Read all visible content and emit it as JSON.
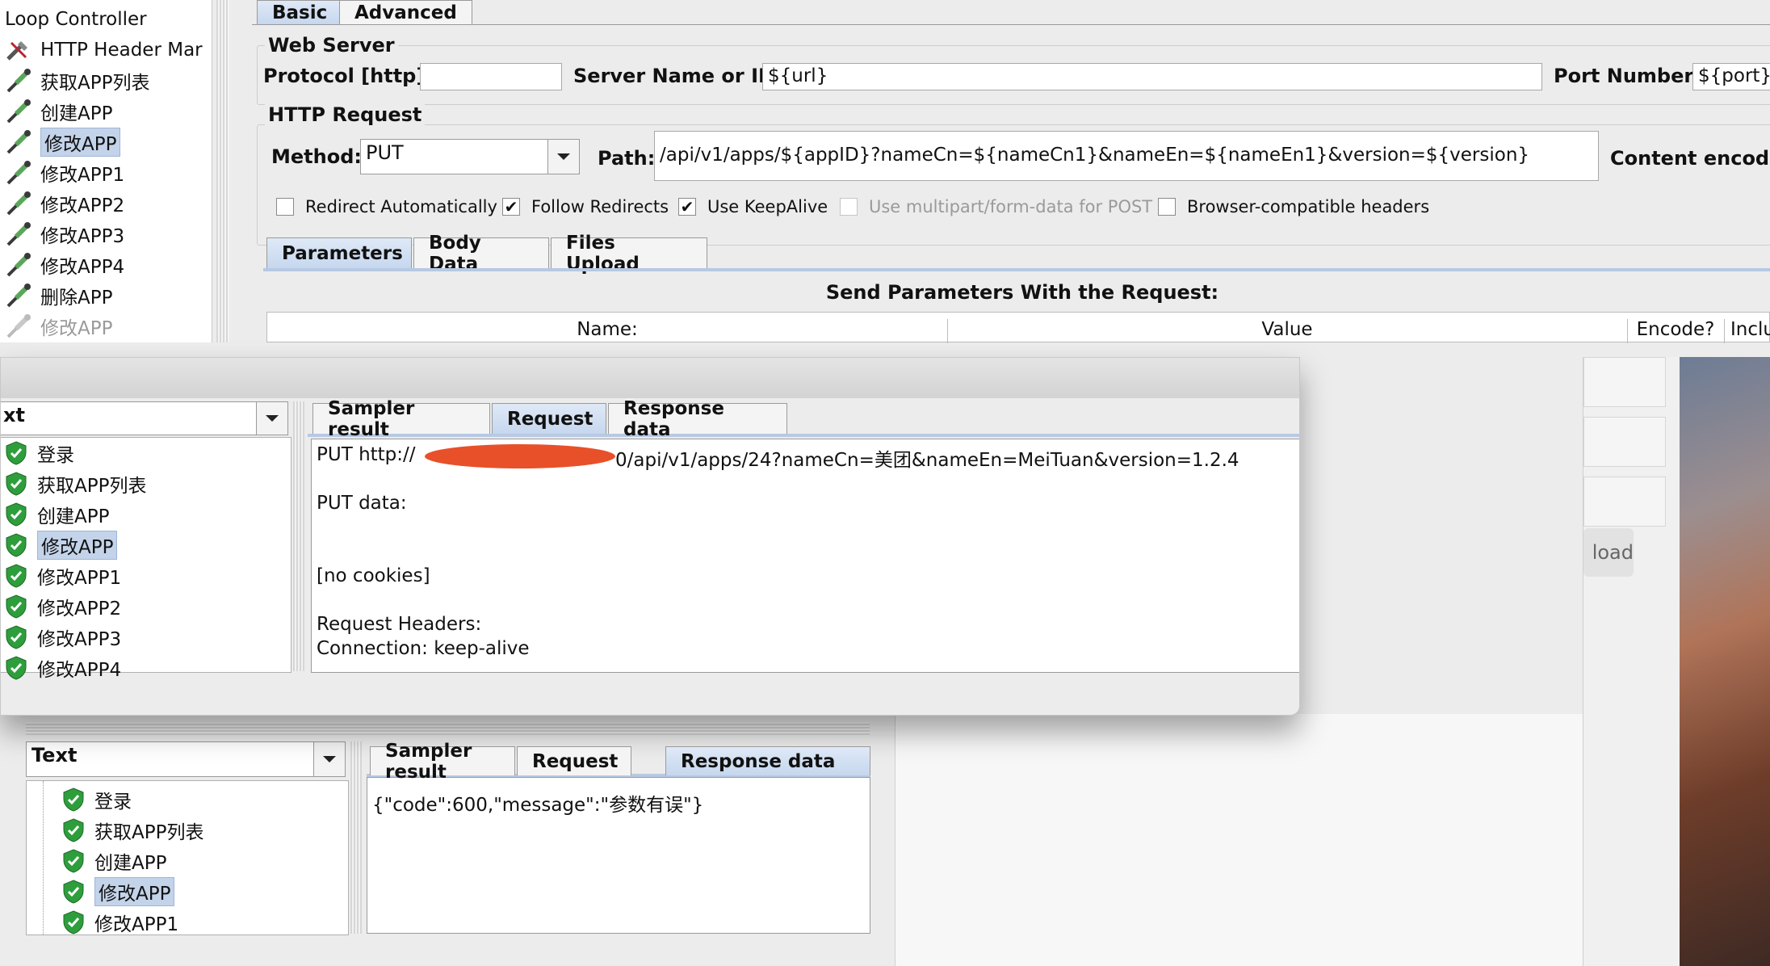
{
  "top_panel": {
    "tree": [
      {
        "label": "Loop Controller",
        "icon": "loop-controller-icon"
      },
      {
        "label": "HTTP Header Mar",
        "icon": "wrench-icon"
      },
      {
        "label": "获取APP列表",
        "icon": "pipette-icon"
      },
      {
        "label": "创建APP",
        "icon": "pipette-icon"
      },
      {
        "label": "修改APP",
        "icon": "pipette-icon",
        "selected": true
      },
      {
        "label": "修改APP1",
        "icon": "pipette-icon"
      },
      {
        "label": "修改APP2",
        "icon": "pipette-icon"
      },
      {
        "label": "修改APP3",
        "icon": "pipette-icon"
      },
      {
        "label": "修改APP4",
        "icon": "pipette-icon"
      },
      {
        "label": "删除APP",
        "icon": "pipette-icon"
      },
      {
        "label": "修改APP",
        "icon": "pipette-icon",
        "disabled": true
      }
    ],
    "tabs": [
      "Basic",
      "Advanced"
    ],
    "web_server": {
      "title": "Web Server",
      "protocol_label": "Protocol [http]:",
      "protocol_value": "",
      "server_label": "Server Name or IP:",
      "server_value": "${url}",
      "port_label": "Port Number:",
      "port_value": "${port}"
    },
    "http_request": {
      "title": "HTTP Request",
      "method_label": "Method:",
      "method_value": "PUT",
      "path_label": "Path:",
      "path_value": "/api/v1/apps/${appID}?nameCn=${nameCn1}&nameEn=${nameEn1}&version=${version}",
      "content_encoding_label": "Content encodin"
    },
    "checkboxes": [
      {
        "label": "Redirect Automatically",
        "checked": false,
        "enabled": true
      },
      {
        "label": "Follow Redirects",
        "checked": true,
        "enabled": true
      },
      {
        "label": "Use KeepAlive",
        "checked": true,
        "enabled": true
      },
      {
        "label": "Use multipart/form-data for POST",
        "checked": false,
        "enabled": false
      },
      {
        "label": "Browser-compatible headers",
        "checked": false,
        "enabled": true
      }
    ],
    "param_tabs": [
      "Parameters",
      "Body Data",
      "Files Upload"
    ],
    "send_params_title": "Send Parameters With the Request:",
    "columns": [
      "Name:",
      "Value",
      "Encode?",
      "Inclu"
    ]
  },
  "mid_window": {
    "combo_value": "xt",
    "results": [
      "登录",
      "获取APP列表",
      "创建APP",
      "修改APP",
      "修改APP1",
      "修改APP2",
      "修改APP3",
      "修改APP4"
    ],
    "selected_index": 3,
    "tabs": [
      "Sampler result",
      "Request",
      "Response data"
    ],
    "active_tab": "Request",
    "request_lines": [
      "PUT http://",
      "0/api/v1/apps/24?nameCn=美团&nameEn=MeiTuan&version=1.2.4",
      "PUT data:",
      "[no cookies]",
      "Request Headers:",
      "Connection: keep-alive"
    ],
    "redaction_color": "#e8502a"
  },
  "bottom_window": {
    "combo_value": "Text",
    "results": [
      "登录",
      "获取APP列表",
      "创建APP",
      "修改APP",
      "修改APP1"
    ],
    "selected_index": 3,
    "tabs": [
      "Sampler result",
      "Request",
      "Response data"
    ],
    "active_tab": "Response data",
    "response_text": "{\"code\":600,\"message\":\"参数有误\"}"
  },
  "background": {
    "upload_button_fragment": "load"
  },
  "colors": {
    "selection": "#c3d3e9",
    "success_green": "#2e9e3c",
    "accent_tab": "#c6d7ee"
  }
}
